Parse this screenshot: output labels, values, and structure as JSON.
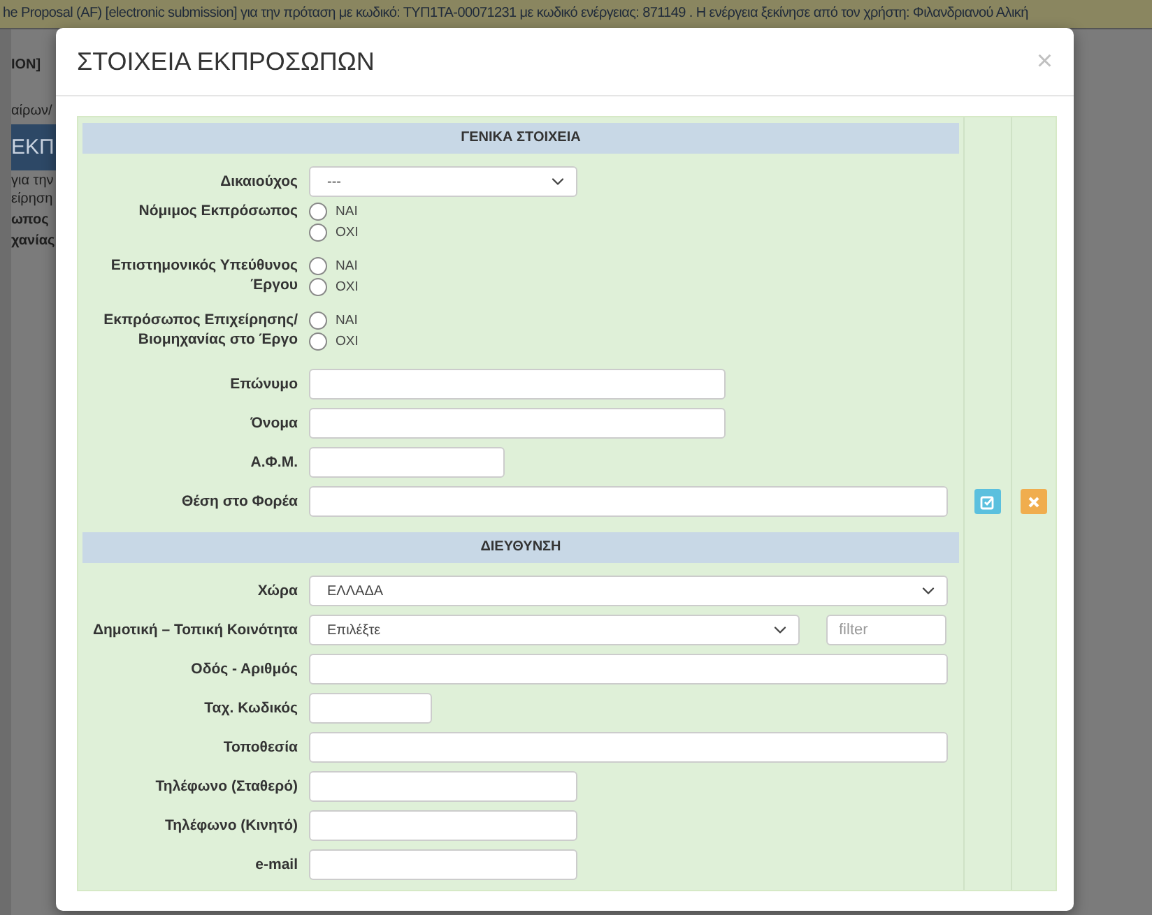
{
  "background_page": {
    "banner": "he Proposal (AF) [electronic submission] για την πρόταση με κωδικό: ΤΥΠ1ΤΑ-00071231 με κωδικό ενέργειας: 871149 . Η ενέργεια ξεκίνησε από τον χρήστη: Φιλανδριανού Αλική",
    "fragments": [
      {
        "text": "ΙΟΝ]",
        "kind": "bar"
      },
      {
        "text": "αίρων/",
        "kind": "crumb"
      },
      {
        "text": "ΕΚΠ",
        "kind": "heading"
      },
      {
        "text": "για την",
        "kind": "note"
      },
      {
        "text": "είρηση",
        "kind": "note"
      },
      {
        "text": "ωπος",
        "kind": "label"
      },
      {
        "text": "χανίας",
        "kind": "label"
      }
    ]
  },
  "dialog": {
    "title": "ΣΤΟΙΧΕΙΑ ΕΚΠΡΟΣΩΠΩΝ",
    "close": "×",
    "sections": [
      {
        "title": "ΓΕΝΙΚΑ ΣΤΟΙΧΕΙΑ",
        "fields": [
          {
            "label": "Δικαιούχος",
            "kind": "select",
            "value": "---"
          },
          {
            "label": "Νόμιμος Εκπρόσωπος",
            "kind": "radio",
            "options": [
              {
                "label": "ΝΑΙ",
                "selected": false
              },
              {
                "label": "ΟΧΙ",
                "selected": false
              }
            ]
          },
          {
            "label": "Επιστημονικός Υπεύθυνος Έργου",
            "kind": "radio",
            "options": [
              {
                "label": "ΝΑΙ",
                "selected": false
              },
              {
                "label": "ΟΧΙ",
                "selected": false
              }
            ]
          },
          {
            "label": "Εκπρόσωπος Επιχείρησης/ Βιομηχανίας στο Έργο",
            "kind": "radio",
            "options": [
              {
                "label": "ΝΑΙ",
                "selected": false
              },
              {
                "label": "ΟΧΙ",
                "selected": false
              }
            ]
          },
          {
            "label": "Επώνυμο",
            "kind": "text"
          },
          {
            "label": "Όνομα",
            "kind": "text"
          },
          {
            "label": "Α.Φ.Μ.",
            "kind": "text"
          },
          {
            "label": "Θέση στο Φορέα",
            "kind": "text"
          }
        ]
      },
      {
        "title": "ΔΙΕΥΘΥΝΣΗ",
        "fields": [
          {
            "label": "Χώρα",
            "kind": "select",
            "value": "ΕΛΛΑΔΑ"
          },
          {
            "label": "Δημοτική – Τοπική Κοινότητα",
            "kind": "select_filter",
            "value": "Επιλέξτε",
            "placeholder": "filter"
          },
          {
            "label": "Οδός - Αριθμός",
            "kind": "text"
          },
          {
            "label": "Ταχ. Κωδικός",
            "kind": "text"
          },
          {
            "label": "Τοποθεσία",
            "kind": "text"
          },
          {
            "label": "Τηλέφωνο (Σταθερό)",
            "kind": "text"
          },
          {
            "label": "Τηλέφωνο (Κινητό)",
            "kind": "text"
          },
          {
            "label": "e-mail",
            "kind": "text"
          }
        ]
      }
    ]
  }
}
